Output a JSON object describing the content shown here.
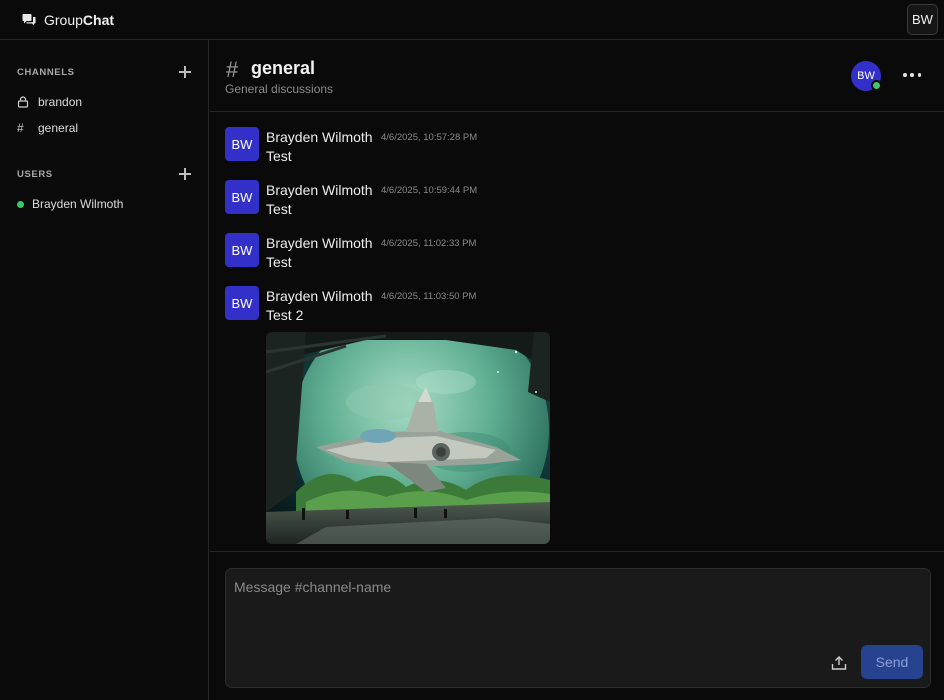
{
  "app": {
    "brand_prefix": "Group",
    "brand_bold": "Chat",
    "user_initials": "BW"
  },
  "sidebar": {
    "channels_title": "CHANNELS",
    "channels": [
      {
        "label": "brandon",
        "icon": "lock-icon"
      },
      {
        "label": "general",
        "icon": "hash-icon"
      }
    ],
    "users_title": "USERS",
    "users": [
      {
        "label": "Brayden Wilmoth",
        "status": "online"
      }
    ]
  },
  "channel": {
    "hash": "#",
    "name": "general",
    "description": "General discussions",
    "member_initials": "BW"
  },
  "messages": [
    {
      "initials": "BW",
      "author": "Brayden Wilmoth",
      "time": "4/6/2025, 10:57:28 PM",
      "text": "Test"
    },
    {
      "initials": "BW",
      "author": "Brayden Wilmoth",
      "time": "4/6/2025, 10:59:44 PM",
      "text": "Test"
    },
    {
      "initials": "BW",
      "author": "Brayden Wilmoth",
      "time": "4/6/2025, 11:02:33 PM",
      "text": "Test"
    },
    {
      "initials": "BW",
      "author": "Brayden Wilmoth",
      "time": "4/6/2025, 11:03:50 PM",
      "text": "Test 2",
      "attachment": "spaceship-planet-image"
    }
  ],
  "composer": {
    "placeholder": "Message #channel-name",
    "send_label": "Send"
  },
  "colors": {
    "avatar": "#3330c9",
    "online": "#3ec76a",
    "send_button": "#27438f"
  }
}
